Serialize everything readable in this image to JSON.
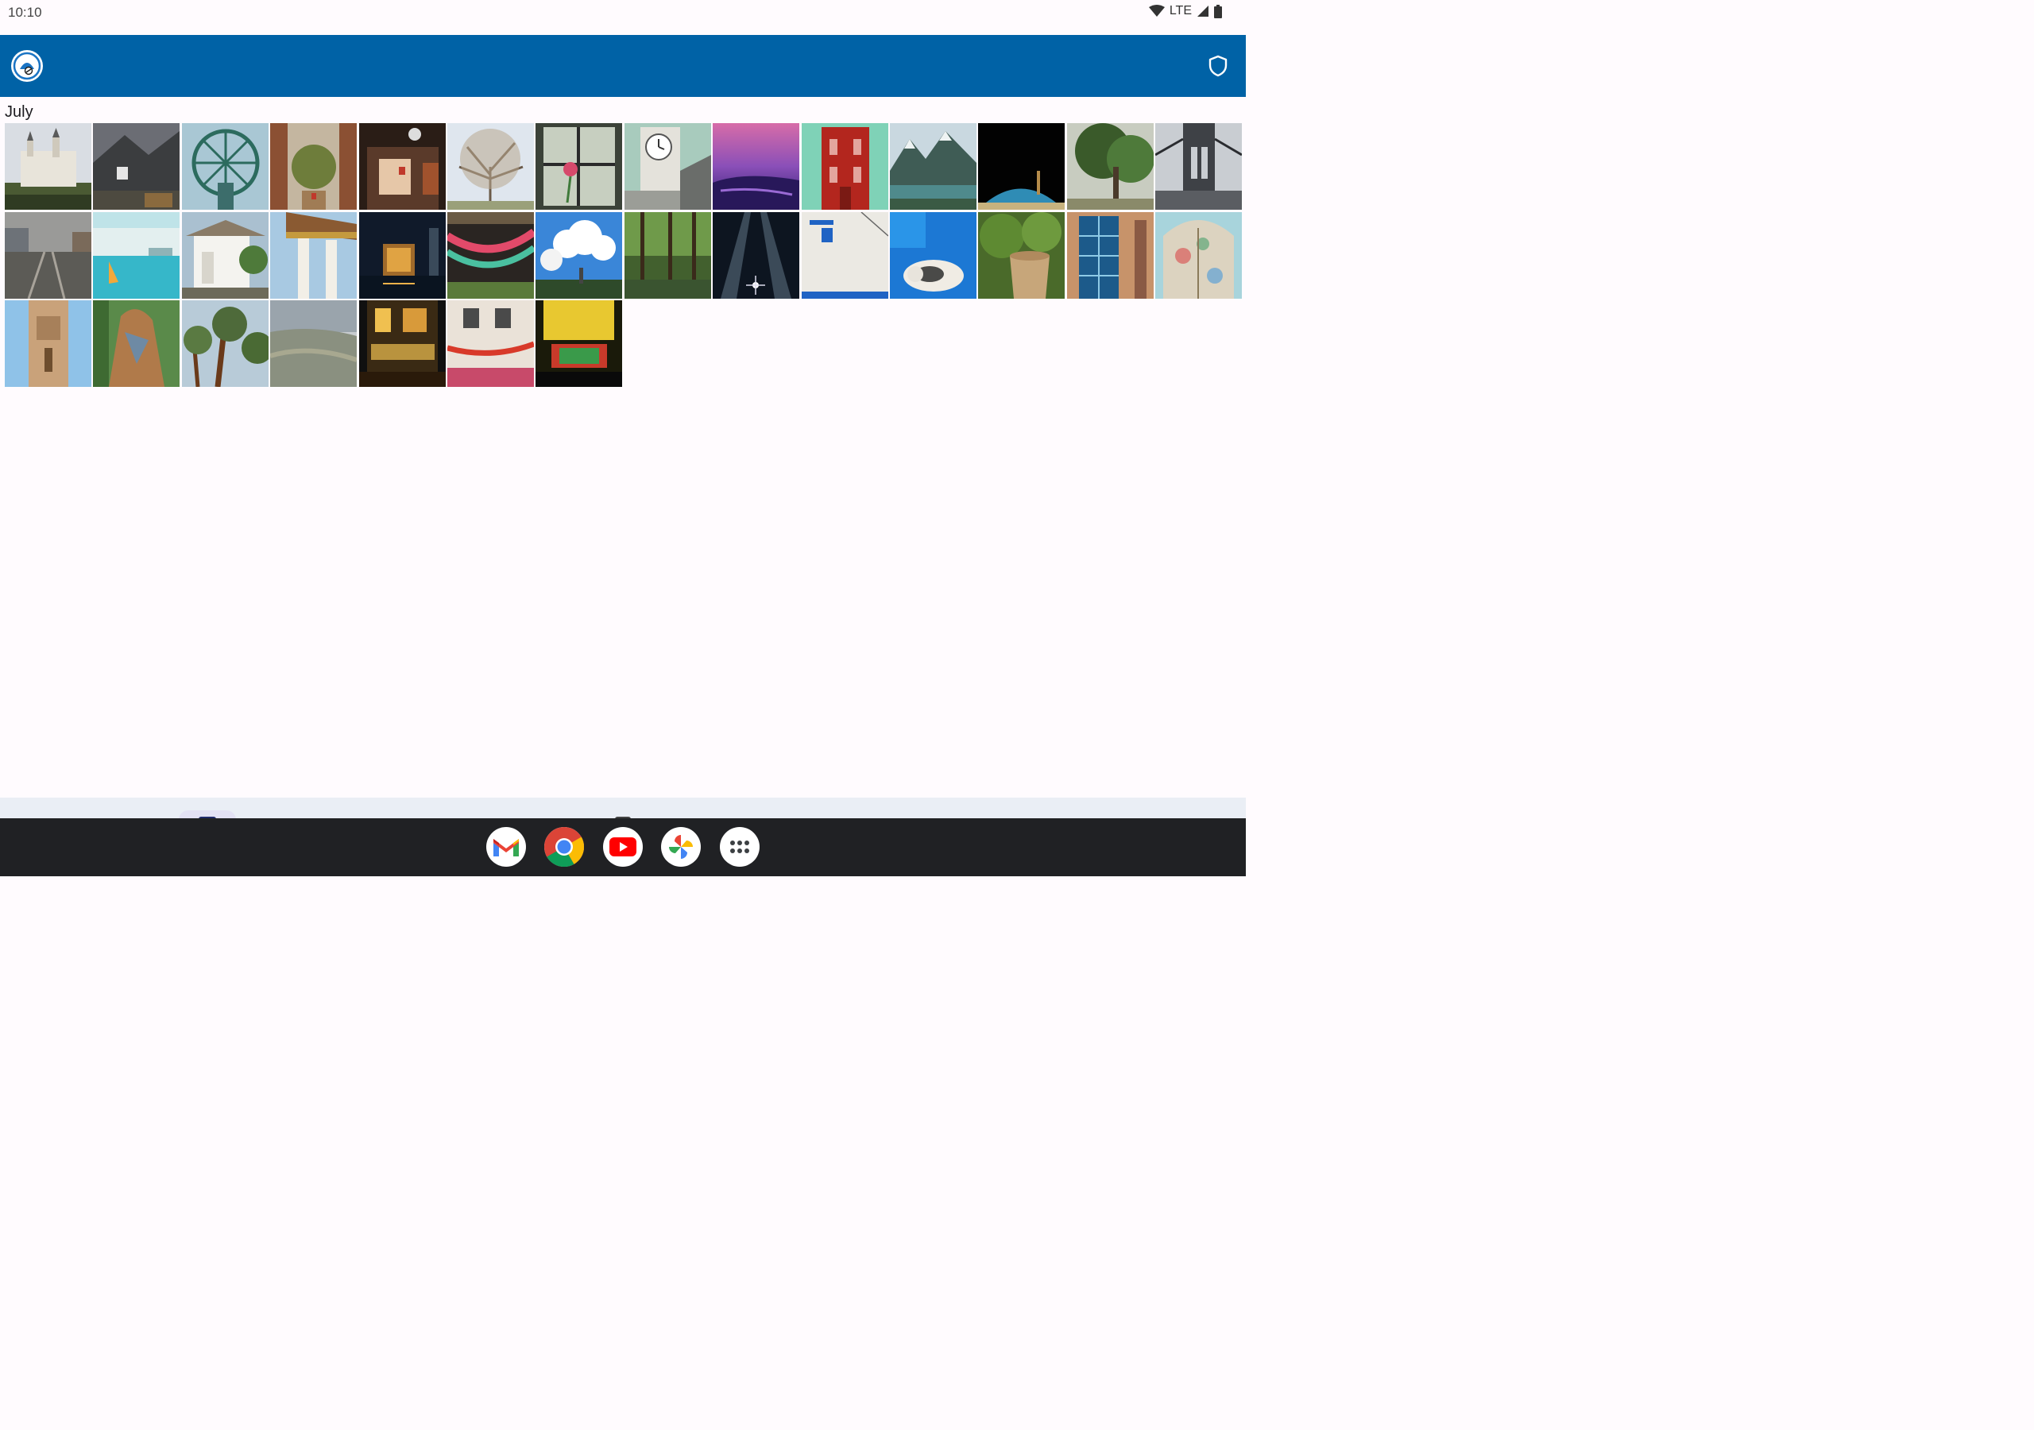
{
  "status": {
    "time": "10:10",
    "network": "LTE",
    "icons": [
      "wifi-icon",
      "cell-signal-icon",
      "battery-icon"
    ]
  },
  "app_bar": {
    "logo_icon": "app-logo-icon",
    "action_icon": "shield-icon",
    "color": "#0062a6"
  },
  "gallery": {
    "section_title": "July",
    "photo_count": 35,
    "photos": [
      "castle-photo",
      "mountain-castle-photo",
      "ferris-wheel-photo",
      "street-corridor-photo",
      "restaurant-night-photo",
      "bare-tree-photo",
      "flower-window-photo",
      "clock-tower-photo",
      "purple-sunset-photo",
      "red-tower-photo",
      "alpine-lake-photo",
      "mosque-dome-photo",
      "green-tree-photo",
      "bridge-photo",
      "rail-street-photo",
      "harbor-sail-photo",
      "white-house-photo",
      "temple-columns-photo",
      "city-night-photo",
      "prayer-flags-photo",
      "clouds-sky-photo",
      "flooded-forest-photo",
      "tower-night-photo",
      "white-wall-photo",
      "blue-cat-photo",
      "garden-pot-photo",
      "blue-window-photo",
      "mosaic-gate-photo",
      "minaret-photo",
      "tree-sculpture-photo",
      "pine-trees-photo",
      "aerial-valley-photo",
      "lit-building-photo",
      "lantern-street-photo",
      "chinatown-photo"
    ]
  },
  "dock": {
    "apps": [
      {
        "name": "gmail-icon"
      },
      {
        "name": "chrome-icon"
      },
      {
        "name": "youtube-icon"
      },
      {
        "name": "photos-icon"
      },
      {
        "name": "app-drawer-icon"
      }
    ]
  }
}
